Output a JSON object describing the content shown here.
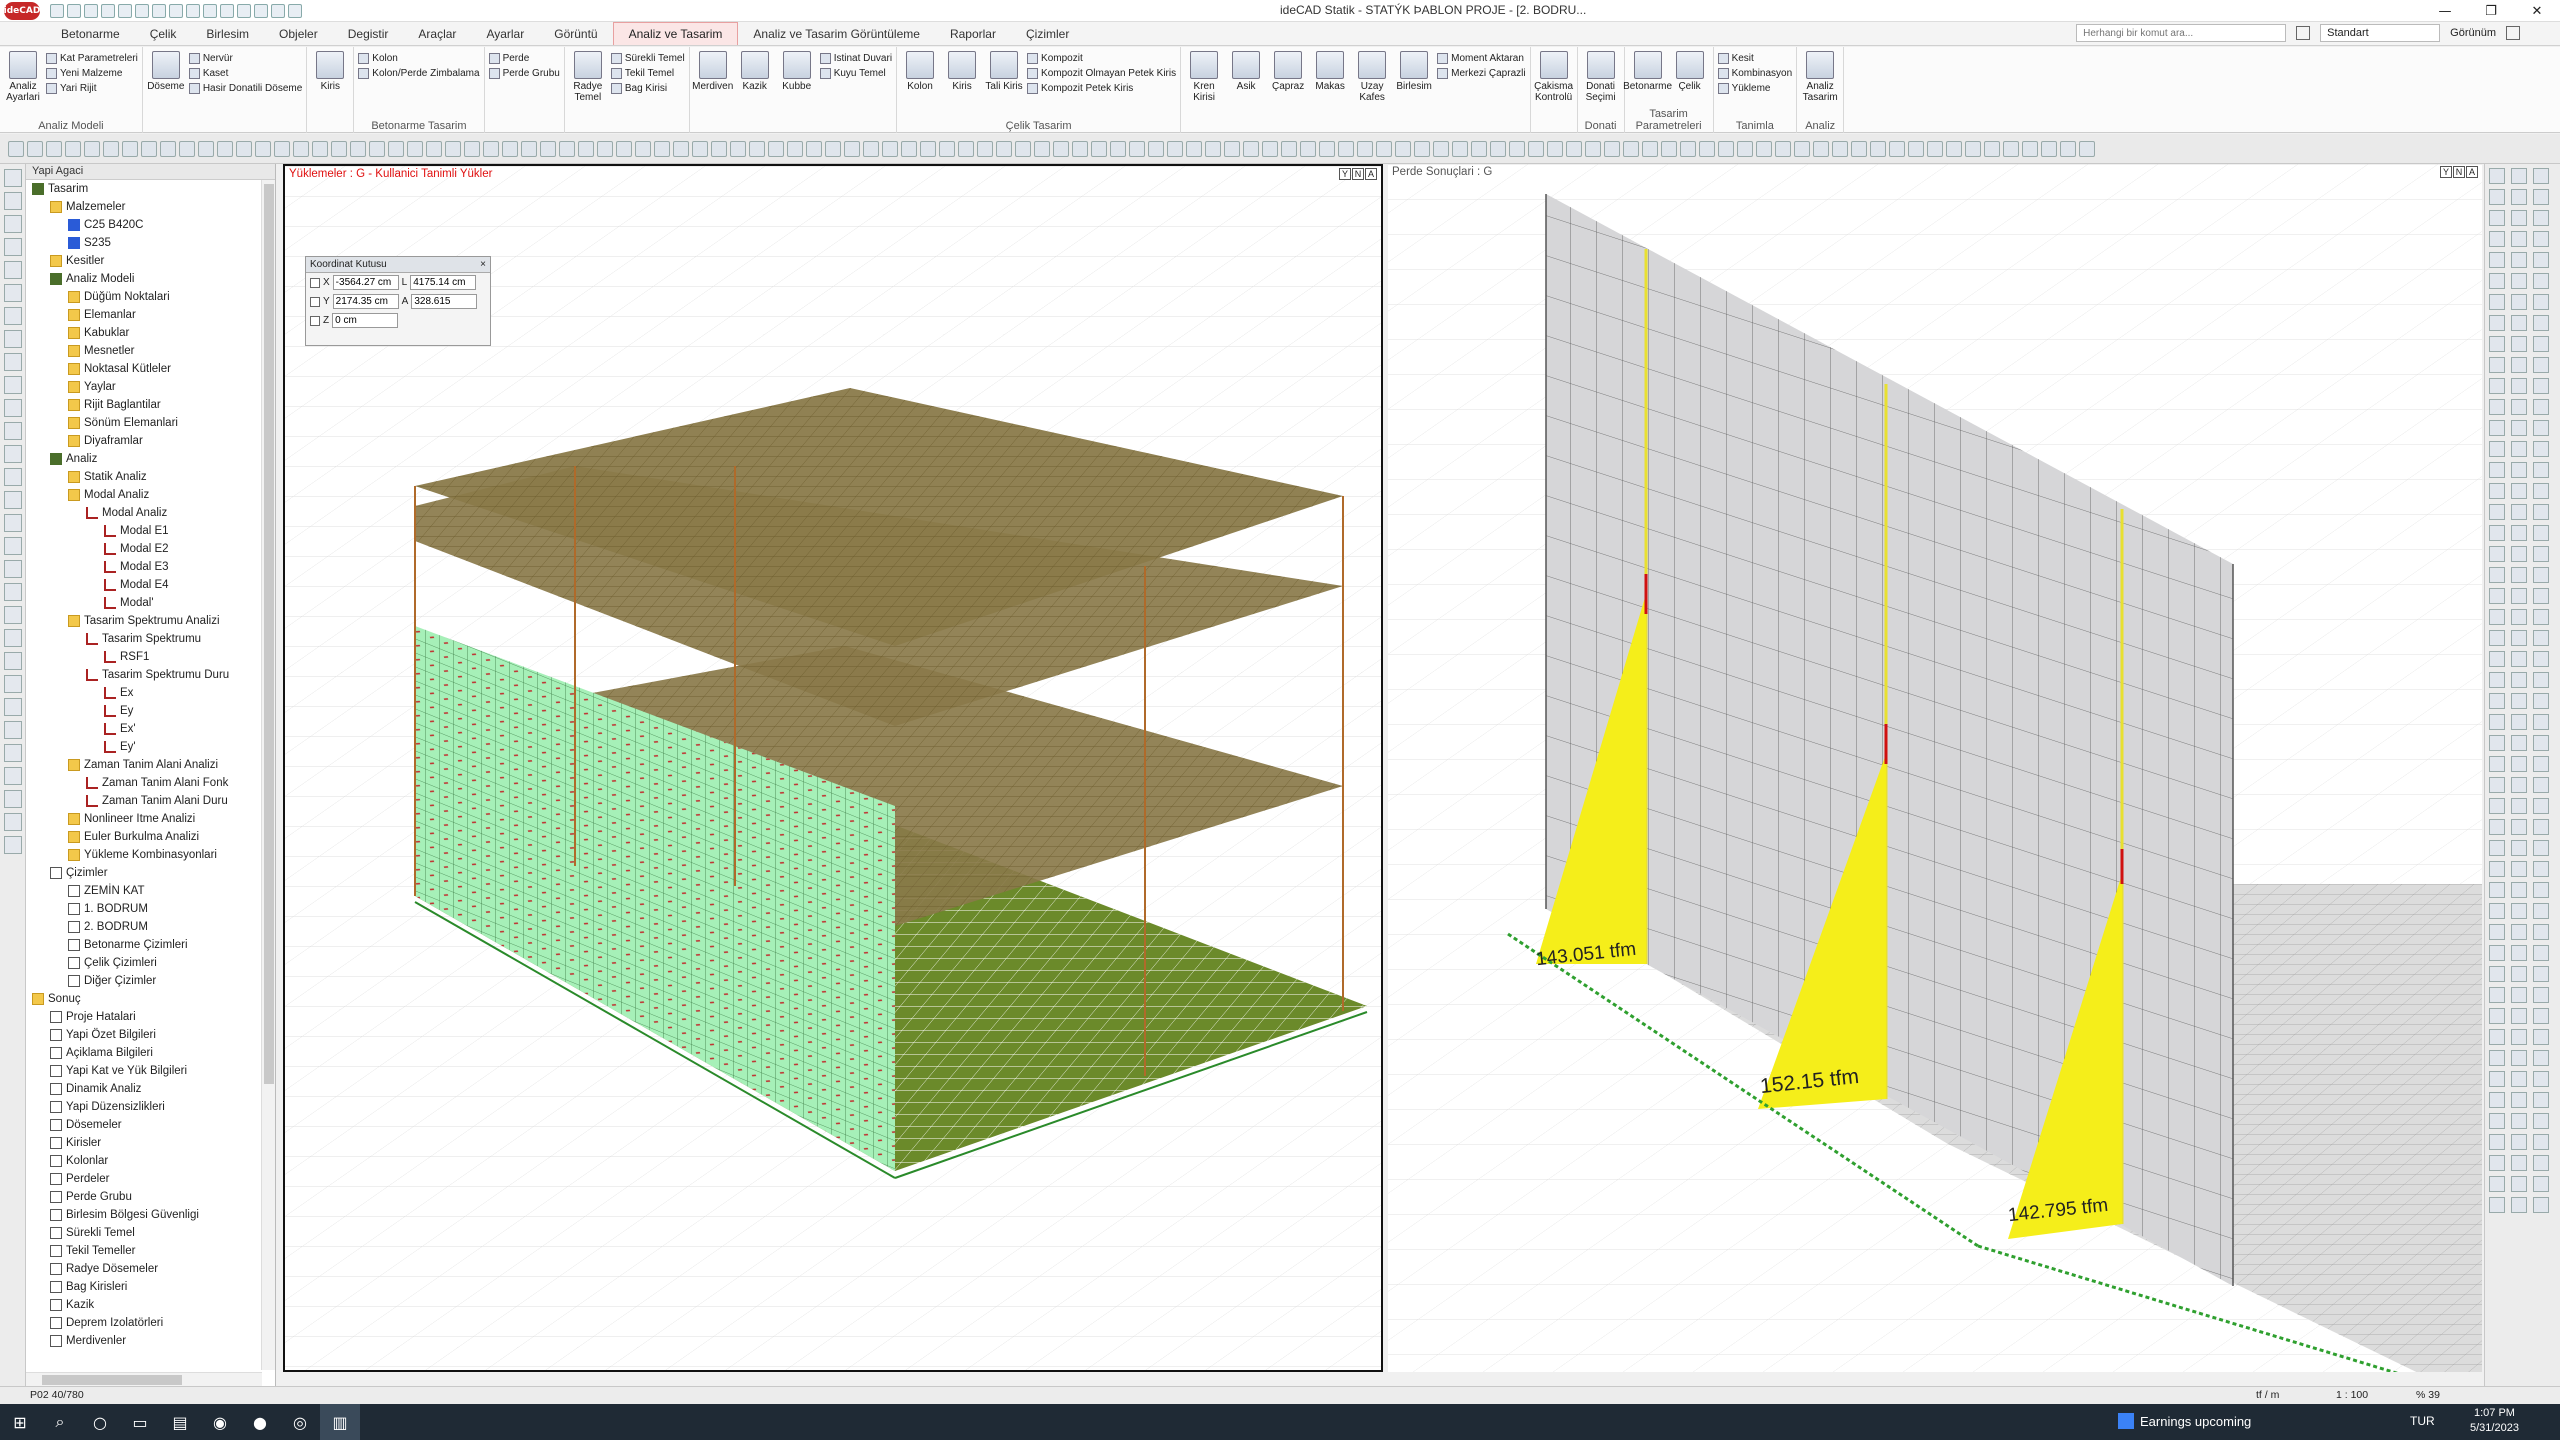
{
  "window": {
    "title": "ideCAD Statik - STATÝK ÞABLON PROJE - [2. BODRU...",
    "logo": "ideCAD",
    "controls": [
      "—",
      "❐",
      "✕"
    ]
  },
  "tabs": [
    "Betonarme",
    "Çelik",
    "Birlesim",
    "Objeler",
    "Degistir",
    "Araçlar",
    "Ayarlar",
    "Görüntü",
    "Analiz ve Tasarim",
    "Analiz ve Tasarim Görüntüleme",
    "Raporlar",
    "Çizimler"
  ],
  "active_tab": "Analiz ve Tasarim",
  "search": {
    "placeholder": "Herhangi bir komut ara..."
  },
  "style_combo": "Standart",
  "view_menu": "Görünüm",
  "ribbon": {
    "groups": [
      {
        "label": "Analiz Modeli",
        "big": [
          "Analiz Ayarlari"
        ],
        "small": [
          "Kat Parametreleri",
          "Yeni Malzeme",
          "Yari Rijit"
        ]
      },
      {
        "label": "",
        "big": [
          "Döseme"
        ],
        "small": [
          "Nervür",
          "Kaset",
          "Hasir Donatili Döseme"
        ]
      },
      {
        "label": "",
        "big": [
          "Kiris"
        ],
        "small": []
      },
      {
        "label": "Betonarme Tasarim",
        "big": [],
        "small": [
          "Kolon",
          "Kolon/Perde Zimbalama"
        ]
      },
      {
        "label": "",
        "big": [],
        "small": [
          "Perde",
          "Perde Grubu"
        ]
      },
      {
        "label": "",
        "big": [
          "Radye Temel"
        ],
        "small": [
          "Sürekli Temel",
          "Tekil Temel",
          "Bag Kirisi"
        ]
      },
      {
        "label": "",
        "big": [
          "Merdiven",
          "Kazik",
          "Kubbe"
        ],
        "small": [
          "Istinat Duvari",
          "Kuyu Temel"
        ]
      },
      {
        "label": "Çelik Tasarim",
        "big": [
          "Kolon",
          "Kiris",
          "Tali Kiris"
        ],
        "small": [
          "Kompozit",
          "Kompozit Olmayan Petek Kiris",
          "Kompozit Petek Kiris"
        ]
      },
      {
        "label": "",
        "big": [
          "Kren Kirisi",
          "Asik",
          "Çapraz",
          "Makas",
          "Uzay Kafes",
          "Birlesim"
        ],
        "small": [
          "Moment Aktaran",
          "Merkezi Çaprazli"
        ]
      },
      {
        "label": "",
        "big": [
          "Çakisma Kontrolü"
        ],
        "small": []
      },
      {
        "label": "Donati",
        "big": [
          "Donati Seçimi"
        ],
        "small": []
      },
      {
        "label": "Tasarim Parametreleri",
        "big": [
          "Betonarme",
          "Çelik"
        ],
        "small": []
      },
      {
        "label": "Tanimla",
        "big": [],
        "small": [
          "Kesit",
          "Kombinasyon",
          "Yükleme"
        ]
      },
      {
        "label": "Analiz",
        "big": [
          "Analiz Tasarim"
        ],
        "small": []
      }
    ]
  },
  "tree": {
    "header": "Yapi Agaci",
    "items": [
      {
        "label": "Tasarim",
        "level": 0,
        "icon": "tree"
      },
      {
        "label": "Malzemeler",
        "level": 1,
        "icon": "folder"
      },
      {
        "label": "C25 B420C",
        "level": 2,
        "icon": "blue"
      },
      {
        "label": "S235",
        "level": 2,
        "icon": "blue"
      },
      {
        "label": "Kesitler",
        "level": 1,
        "icon": "folder"
      },
      {
        "label": "Analiz Modeli",
        "level": 1,
        "icon": "tree"
      },
      {
        "label": "Düğüm Noktalari",
        "level": 2,
        "icon": "folder"
      },
      {
        "label": "Elemanlar",
        "level": 2,
        "icon": "folder"
      },
      {
        "label": "Kabuklar",
        "level": 2,
        "icon": "folder"
      },
      {
        "label": "Mesnetler",
        "level": 2,
        "icon": "folder"
      },
      {
        "label": "Noktasal Kütleler",
        "level": 2,
        "icon": "folder"
      },
      {
        "label": "Yaylar",
        "level": 2,
        "icon": "folder"
      },
      {
        "label": "Rijit Baglantilar",
        "level": 2,
        "icon": "folder"
      },
      {
        "label": "Sönüm Elemanlari",
        "level": 2,
        "icon": "folder"
      },
      {
        "label": "Diyaframlar",
        "level": 2,
        "icon": "folder"
      },
      {
        "label": "Analiz",
        "level": 1,
        "icon": "tree"
      },
      {
        "label": "Statik Analiz",
        "level": 2,
        "icon": "folder"
      },
      {
        "label": "Modal Analiz",
        "level": 2,
        "icon": "folder"
      },
      {
        "label": "Modal Analiz",
        "level": 3,
        "icon": "sig"
      },
      {
        "label": "Modal E1",
        "level": 4,
        "icon": "sig"
      },
      {
        "label": "Modal E2",
        "level": 4,
        "icon": "sig"
      },
      {
        "label": "Modal E3",
        "level": 4,
        "icon": "sig"
      },
      {
        "label": "Modal E4",
        "level": 4,
        "icon": "sig"
      },
      {
        "label": "Modal'",
        "level": 4,
        "icon": "sig"
      },
      {
        "label": "Tasarim Spektrumu Analizi",
        "level": 2,
        "icon": "folder"
      },
      {
        "label": "Tasarim Spektrumu",
        "level": 3,
        "icon": "sig"
      },
      {
        "label": "RSF1",
        "level": 4,
        "icon": "sig"
      },
      {
        "label": "Tasarim Spektrumu Duru",
        "level": 3,
        "icon": "sig"
      },
      {
        "label": "Ex",
        "level": 4,
        "icon": "sig"
      },
      {
        "label": "Ey",
        "level": 4,
        "icon": "sig"
      },
      {
        "label": "Ex'",
        "level": 4,
        "icon": "sig"
      },
      {
        "label": "Ey'",
        "level": 4,
        "icon": "sig"
      },
      {
        "label": "Zaman Tanim Alani Analizi",
        "level": 2,
        "icon": "folder"
      },
      {
        "label": "Zaman Tanim Alani Fonk",
        "level": 3,
        "icon": "sig"
      },
      {
        "label": "Zaman Tanim Alani Duru",
        "level": 3,
        "icon": "sig"
      },
      {
        "label": "Nonlineer Itme Analizi",
        "level": 2,
        "icon": "folder"
      },
      {
        "label": "Euler Burkulma Analizi",
        "level": 2,
        "icon": "folder"
      },
      {
        "label": "Yükleme Kombinasyonlari",
        "level": 2,
        "icon": "folder"
      },
      {
        "label": "Çizimler",
        "level": 1,
        "icon": "pg"
      },
      {
        "label": "ZEMİN KAT",
        "level": 2,
        "icon": "pg"
      },
      {
        "label": "1. BODRUM",
        "level": 2,
        "icon": "pg"
      },
      {
        "label": "2. BODRUM",
        "level": 2,
        "icon": "pg"
      },
      {
        "label": "Betonarme Çizimleri",
        "level": 2,
        "icon": "pg"
      },
      {
        "label": "Çelik Çizimleri",
        "level": 2,
        "icon": "pg"
      },
      {
        "label": "Diğer Çizimler",
        "level": 2,
        "icon": "pg"
      },
      {
        "label": "Sonuç",
        "level": 0,
        "icon": "folder"
      },
      {
        "label": "Proje Hatalari",
        "level": 1,
        "icon": "pg"
      },
      {
        "label": "Yapi Özet Bilgileri",
        "level": 1,
        "icon": "pg"
      },
      {
        "label": "Açiklama Bilgileri",
        "level": 1,
        "icon": "pg"
      },
      {
        "label": "Yapi Kat ve Yük Bilgileri",
        "level": 1,
        "icon": "pg"
      },
      {
        "label": "Dinamik Analiz",
        "level": 1,
        "icon": "pg"
      },
      {
        "label": "Yapi Düzensizlikleri",
        "level": 1,
        "icon": "pg"
      },
      {
        "label": "Dösemeler",
        "level": 1,
        "icon": "pg"
      },
      {
        "label": "Kirisler",
        "level": 1,
        "icon": "pg"
      },
      {
        "label": "Kolonlar",
        "level": 1,
        "icon": "pg"
      },
      {
        "label": "Perdeler",
        "level": 1,
        "icon": "pg"
      },
      {
        "label": "Perde Grubu",
        "level": 1,
        "icon": "pg"
      },
      {
        "label": "Birlesim Bölgesi Güvenligi",
        "level": 1,
        "icon": "pg"
      },
      {
        "label": "Sürekli Temel",
        "level": 1,
        "icon": "pg"
      },
      {
        "label": "Tekil Temeller",
        "level": 1,
        "icon": "pg"
      },
      {
        "label": "Radye Dösemeler",
        "level": 1,
        "icon": "pg"
      },
      {
        "label": "Bag Kirisleri",
        "level": 1,
        "icon": "pg"
      },
      {
        "label": "Kazik",
        "level": 1,
        "icon": "pg"
      },
      {
        "label": "Deprem Izolatörleri",
        "level": 1,
        "icon": "pg"
      },
      {
        "label": "Merdivenler",
        "level": 1,
        "icon": "pg"
      }
    ]
  },
  "viewport_left": {
    "label": "Yüklemeler : G - Kullanici Tanimli Yükler",
    "label_color": "#e01010",
    "coord_box": {
      "title": "Koordinat Kutusu",
      "x_label": "X",
      "x_value": "-3564.27 cm",
      "y_label": "Y",
      "y_value": "2174.35 cm",
      "z_label": "Z",
      "z_value": "0 cm",
      "l_label": "L",
      "l_value": "4175.14 cm",
      "a_label": "A",
      "a_value": "328.615"
    }
  },
  "viewport_right": {
    "label": "Perde Sonuçlari : G",
    "results": [
      "143.051 tfm",
      "152.15 tfm",
      "142.795 tfm"
    ]
  },
  "viewport_controls": [
    "Y",
    "N",
    "A"
  ],
  "status": {
    "left": "P02 40/780",
    "unit": "tf / m",
    "scale": "1 : 100",
    "zoom": "% 39"
  },
  "taskbar": {
    "news": "Earnings upcoming",
    "lang": "TUR",
    "time": "1:07 PM",
    "date": "5/31/2023"
  }
}
